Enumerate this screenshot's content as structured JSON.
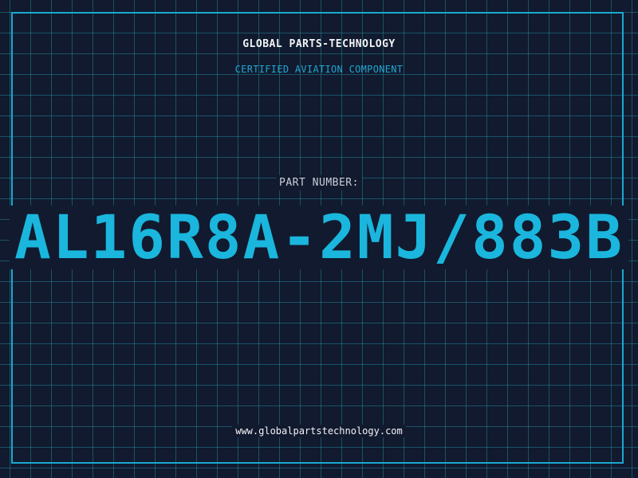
{
  "header": {
    "company": "GLOBAL PARTS-TECHNOLOGY",
    "subtitle": "CERTIFIED AVIATION COMPONENT"
  },
  "part": {
    "label": "PART NUMBER:",
    "number": "AL16R8A-2MJ/883B"
  },
  "footer": {
    "url": "www.globalpartstechnology.com"
  },
  "colors": {
    "background": "#111a2e",
    "grid": "#1e5f74",
    "accent": "#1ab6dd",
    "text": "#f2f4f7"
  }
}
